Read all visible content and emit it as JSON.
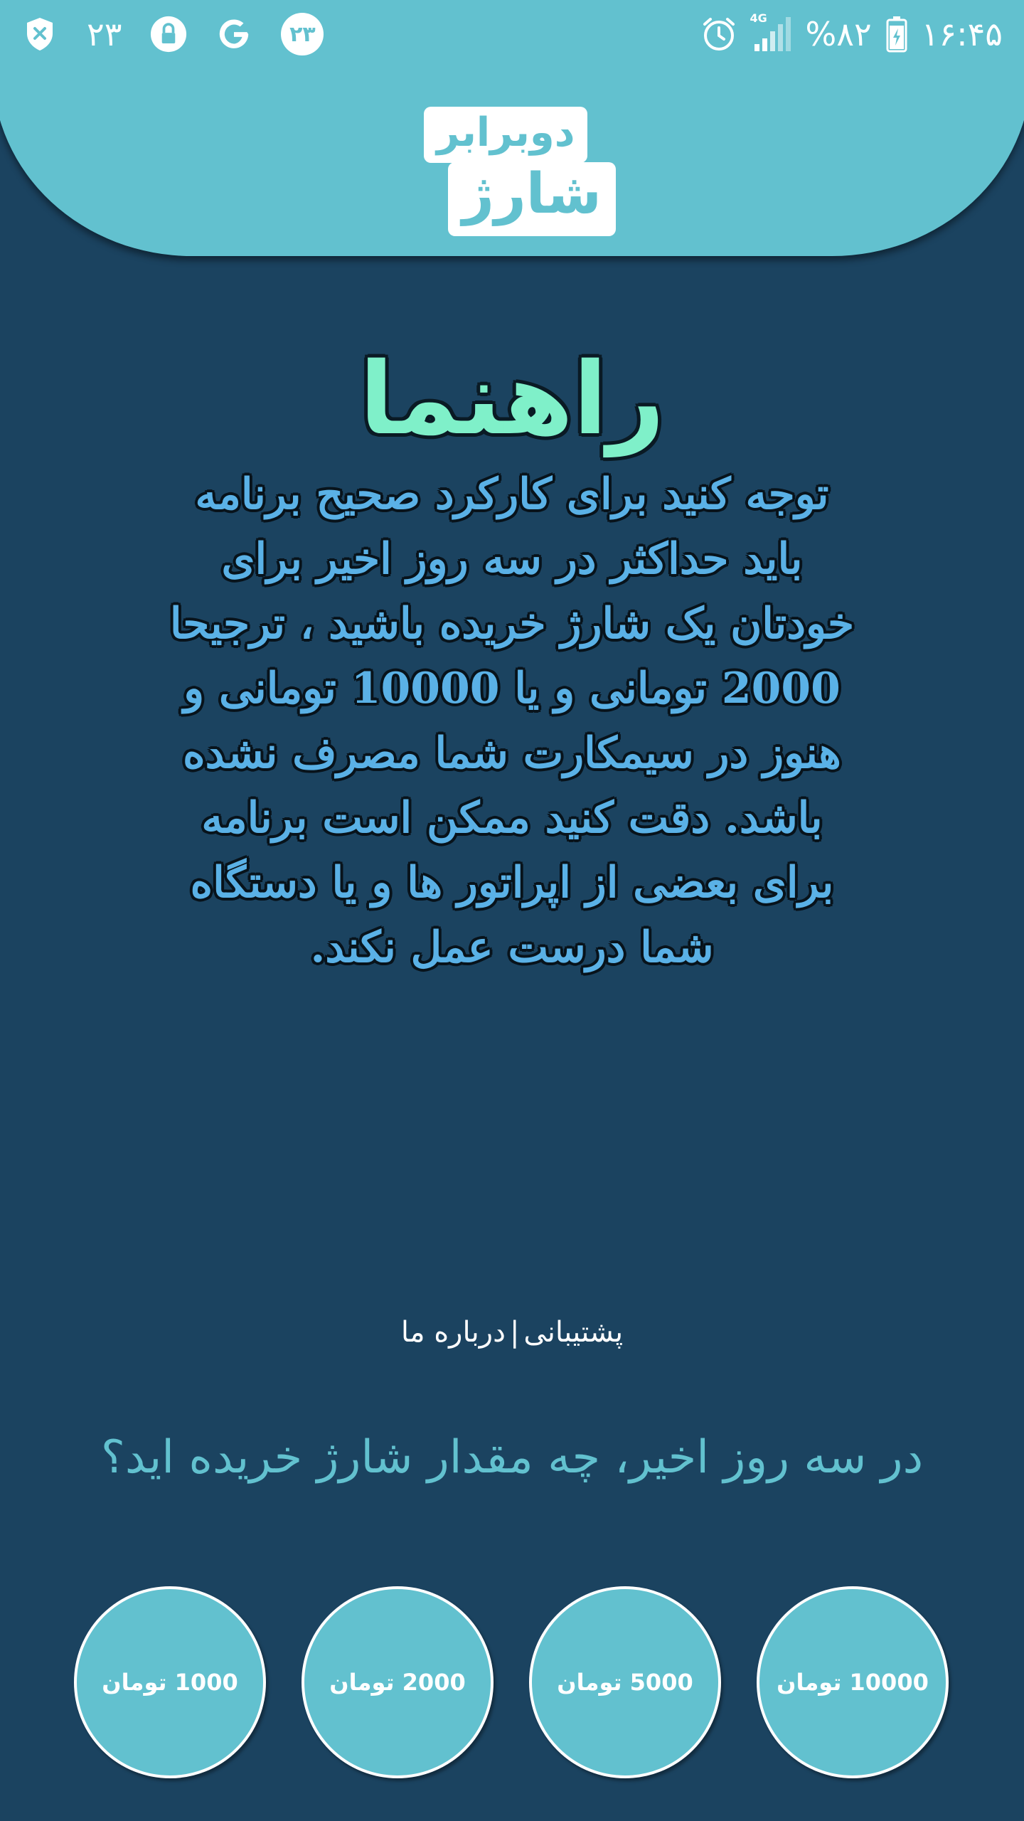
{
  "status_bar": {
    "time": "۱۶:۴۵",
    "battery": "%۸۲",
    "network": "4G",
    "left_count_1": "۲۳",
    "left_count_2": "۲۳",
    "left_g": "G",
    "icons": [
      "shield-x-icon",
      "lock-icon",
      "google-icon",
      "alarm-icon",
      "signal-icon",
      "battery-icon"
    ]
  },
  "logo": {
    "line1": "دوبرابر",
    "line2": "شارژ"
  },
  "guide": {
    "title": "راهنما",
    "body": "توجه کنید برای کارکرد صحیح برنامه باید حداکثر در سه روز اخیر برای خودتان یک شارژ خریده باشید ، ترجیحا 2000 تومانی و یا 10000 تومانی و هنوز در سیمکارت شما مصرف نشده باشد. دقت کنید ممکن است برنامه برای بعضی از اپراتور ها و یا دستگاه شما درست عمل نکند."
  },
  "links": {
    "support": "پشتیبانی",
    "separator": "|",
    "about": "درباره ما"
  },
  "question": "در سه روز اخیر، چه مقدار شارژ خریده اید؟",
  "amounts": [
    {
      "label": "10000 تومان"
    },
    {
      "label": "5000 تومان"
    },
    {
      "label": "2000 تومان"
    },
    {
      "label": "1000 تومان"
    }
  ],
  "colors": {
    "background": "#1b4360",
    "accent": "#62c1cf",
    "title_green": "#7ff0c9",
    "body_blue": "#5ab1e6"
  }
}
